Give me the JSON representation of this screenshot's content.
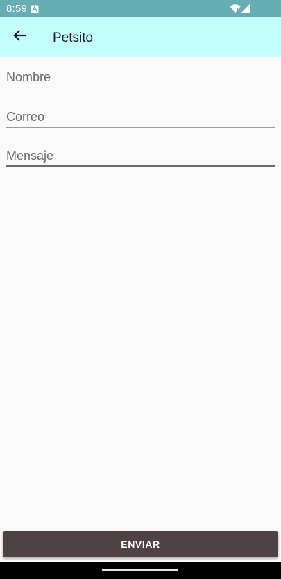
{
  "status_bar": {
    "time": "8:59",
    "background": "#66aeb4"
  },
  "app_bar": {
    "title": "Petsito",
    "back_icon": "arrow-back-icon",
    "background": "#c3ffff"
  },
  "form": {
    "fields": [
      {
        "placeholder": "Nombre",
        "value": ""
      },
      {
        "placeholder": "Correo",
        "value": ""
      },
      {
        "placeholder": "Mensaje",
        "value": ""
      }
    ]
  },
  "submit": {
    "label": "ENVIAR",
    "background": "#4e4244"
  }
}
